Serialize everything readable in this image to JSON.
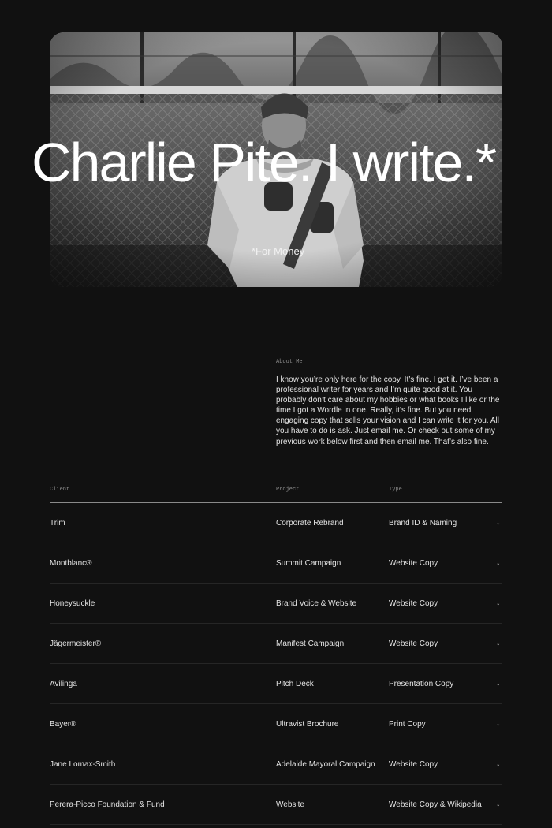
{
  "hero": {
    "title": "Charlie Pite. I write.*",
    "footnote": "*For Money"
  },
  "about": {
    "label": "About Me",
    "text_before_link": "I know you’re only here for the copy. It’s fine. I get it. I’ve been a professional writer for years and I’m quite good at it. You probably don’t care about my hobbies or what books I like or the time I got a Wordle in one. Really, it’s fine. But you need engaging copy that sells your vision and I can write it for you. All you have to do is ask. Just ",
    "link_text": "email me",
    "text_after_link": ". Or check out some of my previous work below first and then email me. That’s also fine."
  },
  "table": {
    "headers": {
      "client": "Client",
      "project": "Project",
      "type": "Type"
    },
    "arrow_icon": "arrow-down-icon",
    "rows": [
      {
        "client": "Trim",
        "project": "Corporate Rebrand",
        "type": "Brand ID & Naming",
        "arrow": "↓"
      },
      {
        "client": "Montblanc®",
        "project": "Summit Campaign",
        "type": "Website Copy",
        "arrow": "↓"
      },
      {
        "client": "Honeysuckle",
        "project": "Brand Voice & Website",
        "type": "Website Copy",
        "arrow": "↓"
      },
      {
        "client": "Jägermeister®",
        "project": "Manifest Campaign",
        "type": "Website Copy",
        "arrow": "↓"
      },
      {
        "client": "Avilinga",
        "project": "Pitch Deck",
        "type": "Presentation Copy",
        "arrow": "↓"
      },
      {
        "client": "Bayer®",
        "project": "Ultravist Brochure",
        "type": "Print Copy",
        "arrow": "↓"
      },
      {
        "client": "Jane Lomax-Smith",
        "project": "Adelaide Mayoral Campaign",
        "type": "Website Copy",
        "arrow": "↓"
      },
      {
        "client": "Perera-Picco Foundation & Fund",
        "project": "Website",
        "type": "Website Copy & Wikipedia",
        "arrow": "↓"
      }
    ]
  },
  "colors": {
    "background": "#111111",
    "text": "#e4e4e4",
    "muted": "#8c8c8c",
    "divider": "#262626"
  }
}
